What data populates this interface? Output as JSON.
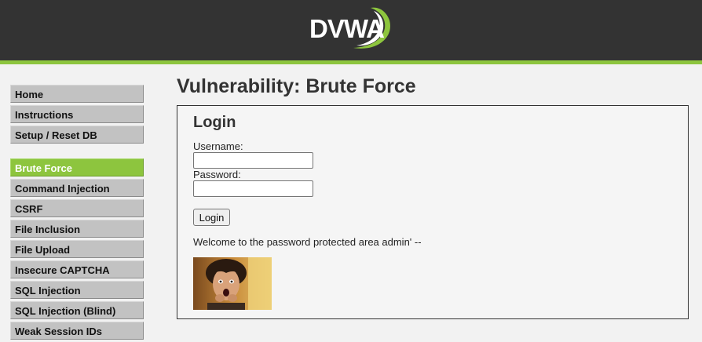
{
  "header": {
    "logo_text": "DVWA"
  },
  "sidebar": {
    "groups": [
      {
        "items": [
          {
            "label": "Home"
          },
          {
            "label": "Instructions"
          },
          {
            "label": "Setup / Reset DB"
          }
        ]
      },
      {
        "items": [
          {
            "label": "Brute Force",
            "active": true
          },
          {
            "label": "Command Injection"
          },
          {
            "label": "CSRF"
          },
          {
            "label": "File Inclusion"
          },
          {
            "label": "File Upload"
          },
          {
            "label": "Insecure CAPTCHA"
          },
          {
            "label": "SQL Injection"
          },
          {
            "label": "SQL Injection (Blind)"
          },
          {
            "label": "Weak Session IDs"
          }
        ]
      }
    ]
  },
  "main": {
    "title": "Vulnerability: Brute Force",
    "login": {
      "heading": "Login",
      "username_label": "Username:",
      "username_value": "",
      "password_label": "Password:",
      "password_value": "",
      "button_label": "Login",
      "message": "Welcome to the password protected area admin' --",
      "photo_icon": "user-avatar-photo"
    }
  },
  "colors": {
    "header_bg": "#333333",
    "accent_green": "#8dc53e",
    "menu_bg": "#c2c2c2",
    "page_bg": "#f2f2f2"
  }
}
